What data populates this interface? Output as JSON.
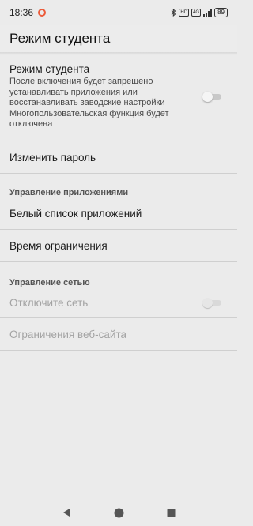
{
  "status_bar": {
    "time": "18:36",
    "network_tag": "4G",
    "battery": "89",
    "icons": [
      "record-icon",
      "bluetooth-icon",
      "hd-icon",
      "signal-icon",
      "battery-icon"
    ]
  },
  "header": {
    "title": "Режим студента"
  },
  "student_mode": {
    "title": "Режим студента",
    "summary_lines": [
      "После включения будет запрещено",
      "устанавливать приложения или",
      "восстанавливать заводские настройки",
      "Многопользовательская функция будет",
      "отключена"
    ],
    "enabled": false
  },
  "change_password": {
    "title": "Изменить пароль"
  },
  "app_management": {
    "header": "Управление приложениями",
    "whitelist_title": "Белый список приложений",
    "time_limit_title": "Время ограничения"
  },
  "network_management": {
    "header": "Управление сетью",
    "disable_network_title": "Отключите сеть",
    "disable_network_enabled": false,
    "disable_network_available": false,
    "website_limits_title": "Ограничения веб-сайта"
  },
  "nav_bar": {
    "icons": [
      "back-icon",
      "home-icon",
      "recents-icon"
    ]
  },
  "colors": {
    "background": "#ebebeb",
    "accent_record": "#ec5b3a",
    "disabled_text": "#a3a3a3"
  }
}
